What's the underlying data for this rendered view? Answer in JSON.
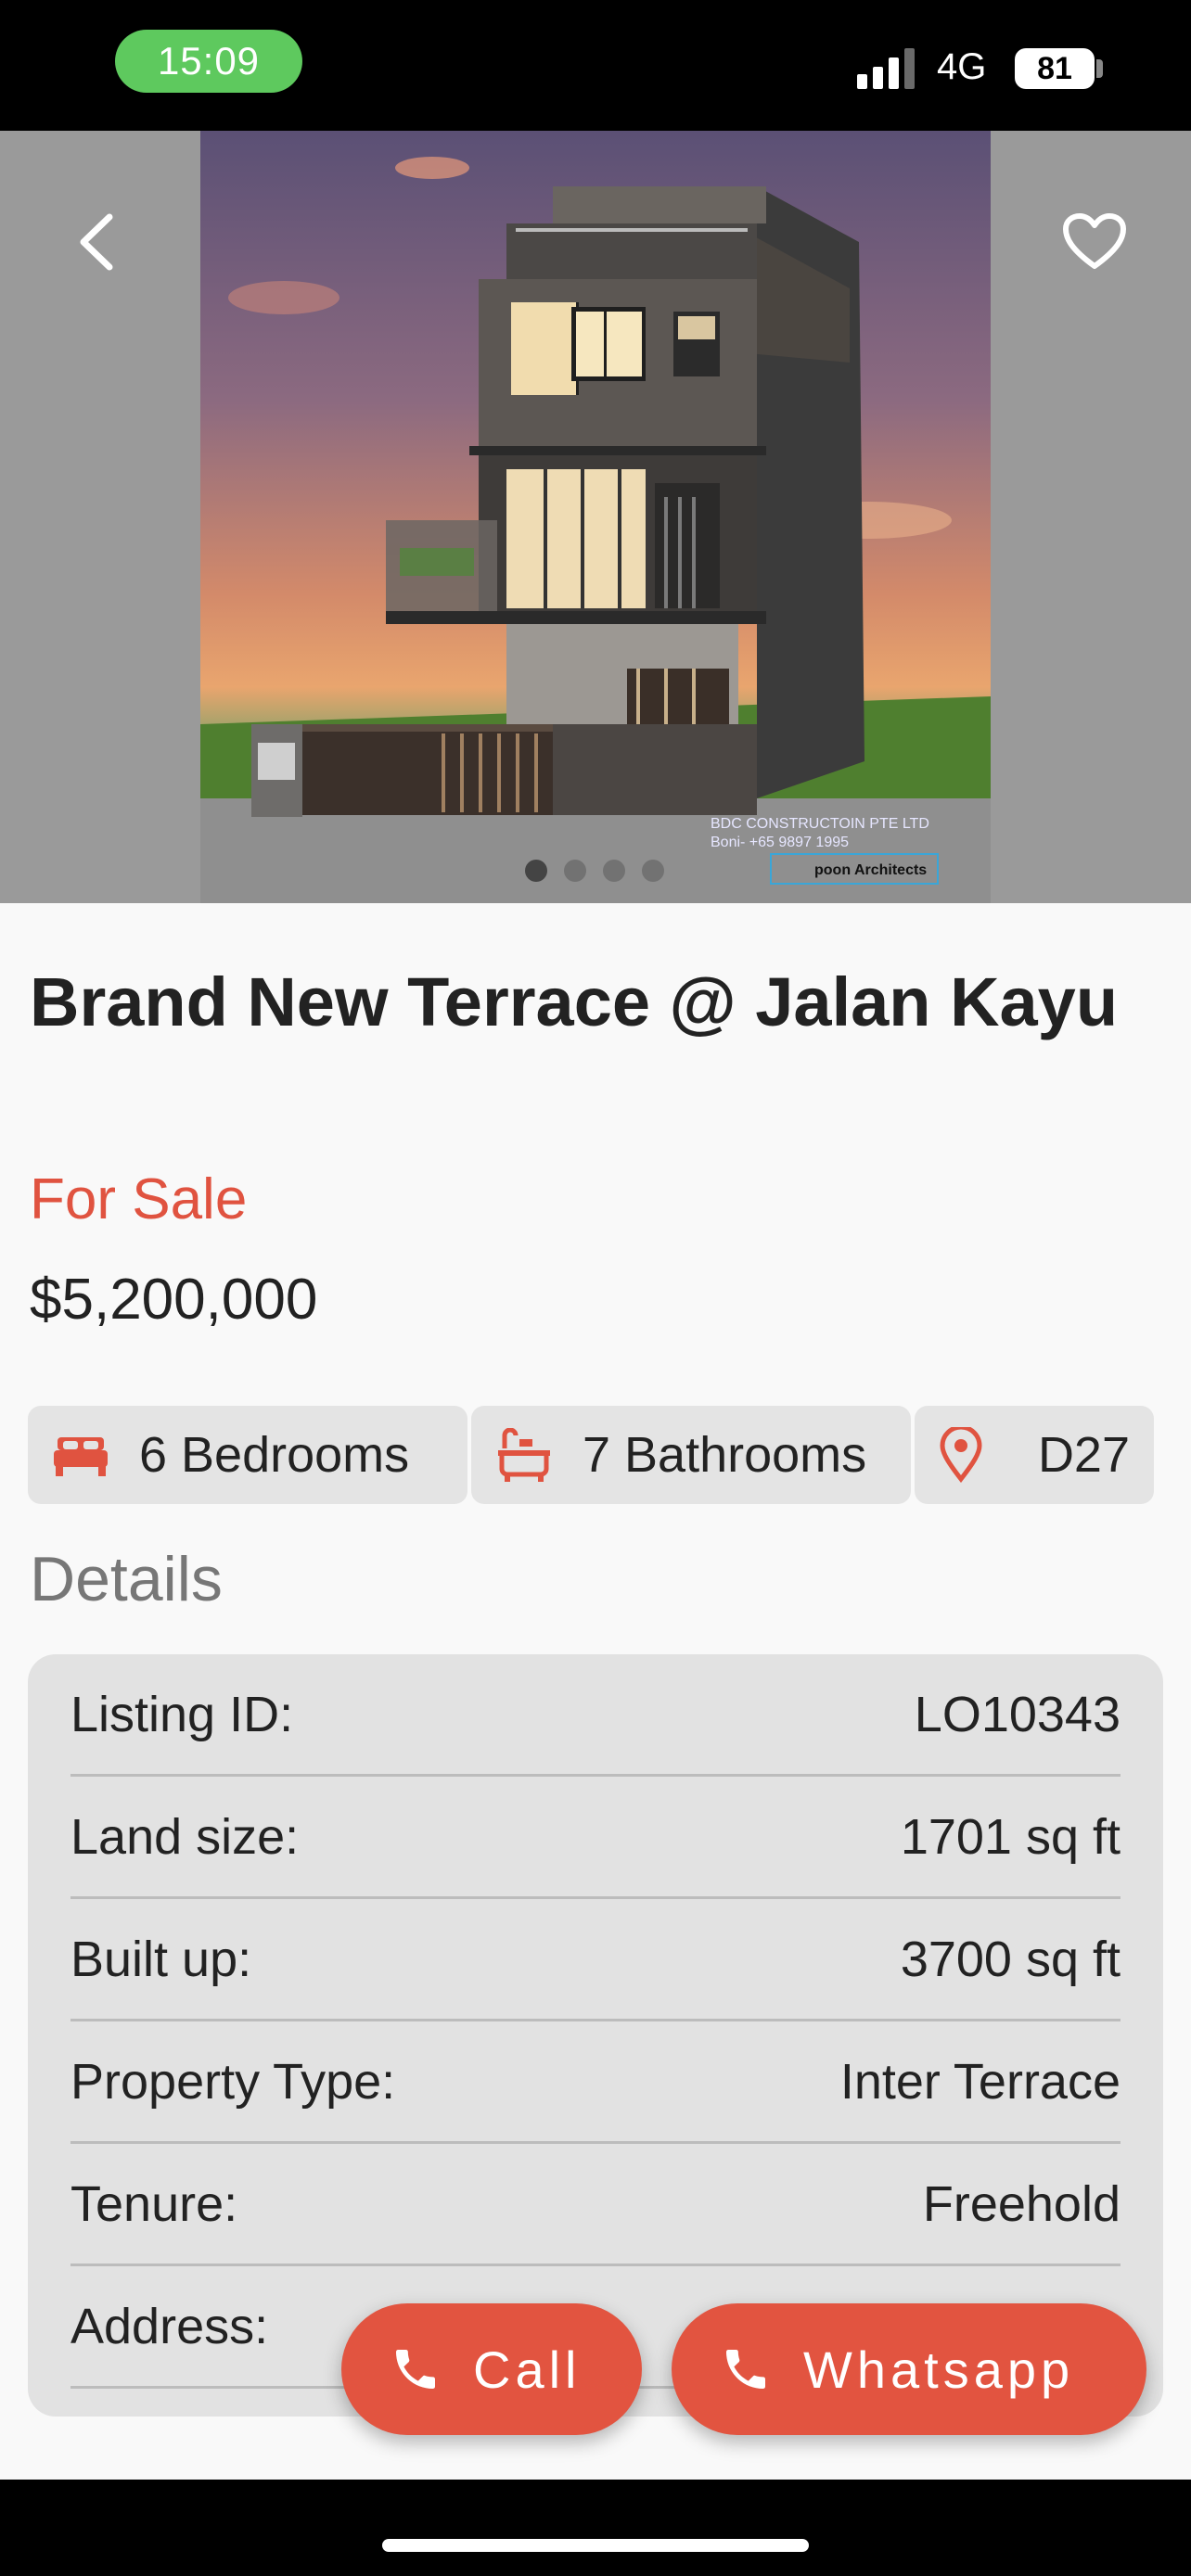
{
  "status_bar": {
    "time": "15:09",
    "network": "4G",
    "battery": "81"
  },
  "hero": {
    "image_caption_line1": "BDC CONSTRUCTOIN PTE LTD",
    "image_caption_line2": "Boni- +65 9897 1995",
    "image_logo_text": "poon Architects",
    "page_count": 4,
    "active_page": 1
  },
  "listing": {
    "title": "Brand New Terrace @ Jalan Kayu",
    "status": "For Sale",
    "price": "$5,200,000"
  },
  "features": {
    "bedrooms": "6 Bedrooms",
    "bathrooms": "7 Bathrooms",
    "district": "D27"
  },
  "details": {
    "heading": "Details",
    "rows": [
      {
        "label": "Listing ID:",
        "value": "LO10343"
      },
      {
        "label": "Land size:",
        "value": "1701 sq ft"
      },
      {
        "label": "Built up:",
        "value": "3700 sq ft"
      },
      {
        "label": "Property Type:",
        "value": "Inter Terrace"
      },
      {
        "label": "Tenure:",
        "value": "Freehold"
      },
      {
        "label": "Address:",
        "value": ""
      }
    ]
  },
  "actions": {
    "call_label": "Call",
    "whatsapp_label": "Whatsapp"
  },
  "colors": {
    "accent": "#e25440",
    "sale_text": "#e05340",
    "chip_bg": "#e4e4e4",
    "card_bg": "#e2e2e2"
  }
}
